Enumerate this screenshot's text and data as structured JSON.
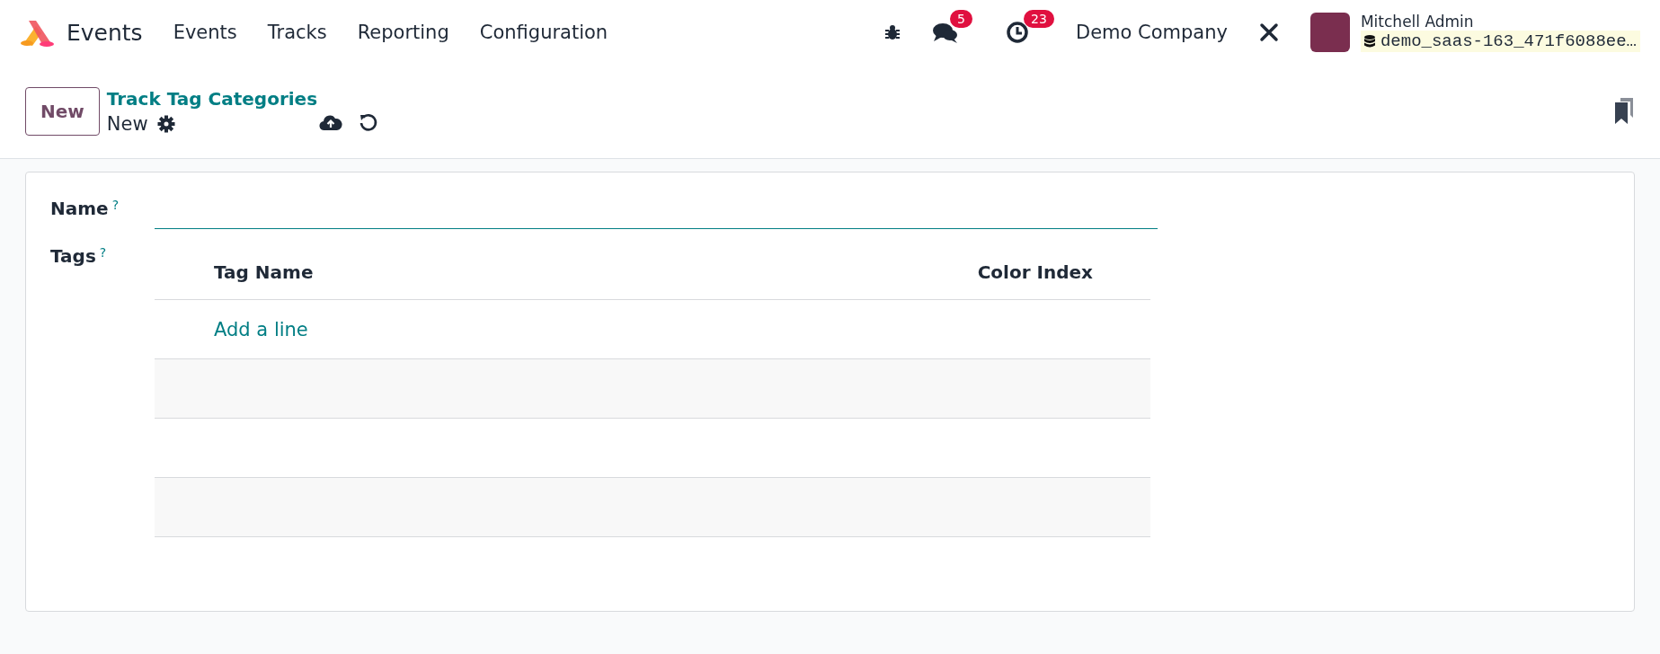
{
  "navbar": {
    "app_name": "Events",
    "menu": [
      "Events",
      "Tracks",
      "Reporting",
      "Configuration"
    ],
    "messages_badge": "5",
    "activities_badge": "23",
    "company": "Demo Company",
    "user_name": "Mitchell Admin",
    "database": "demo_saas-163_471f6088ee…"
  },
  "control_panel": {
    "new_button": "New",
    "breadcrumb": "Track Tag Categories",
    "record_title": "New"
  },
  "form": {
    "name": {
      "label": "Name",
      "help": "?"
    },
    "tags": {
      "label": "Tags",
      "help": "?",
      "columns": [
        "Tag Name",
        "Color Index"
      ],
      "add_line": "Add a line"
    }
  }
}
